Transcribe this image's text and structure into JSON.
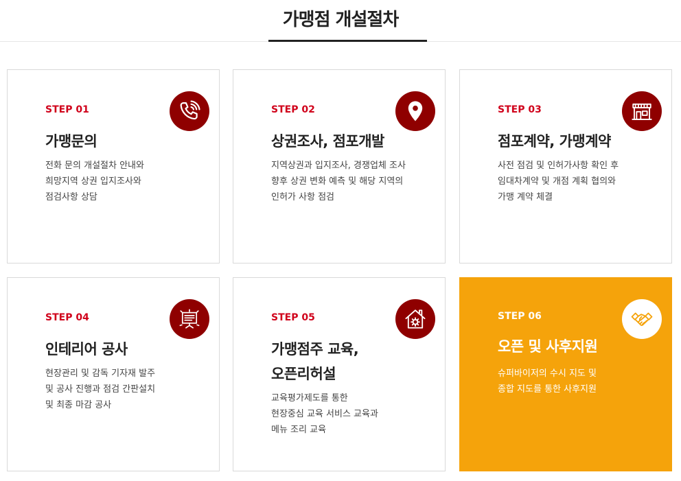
{
  "header": {
    "title": "가맹점 개설절차"
  },
  "steps": [
    {
      "step": "STEP 01",
      "title": "가맹문의",
      "icon": "phone-icon",
      "lines": [
        "전화 문의 개설절차 안내와",
        "희망지역 상권 입지조사와",
        "점검사항 상담"
      ]
    },
    {
      "step": "STEP 02",
      "title": "상권조사, 점포개발",
      "icon": "location-pin-icon",
      "lines": [
        "지역상권과 입지조사, 경쟁업체 조사",
        "향후 상권 변화 예측 및 해당 지역의",
        "인허가 사항 점검"
      ]
    },
    {
      "step": "STEP 03",
      "title": "점포계약, 가맹계약",
      "icon": "storefront-icon",
      "lines": [
        "사전 점검 및 인허가사항 확인 후",
        "임대차계약 및 개점 계획 협의와",
        "가맹 계약 체결"
      ]
    },
    {
      "step": "STEP 04",
      "title": "인테리어 공사",
      "icon": "signboard-icon",
      "lines": [
        "현장관리 및 감독 기자재 발주",
        "및 공사 진행과 점검 간판설치",
        "및 최종 마감 공사"
      ]
    },
    {
      "step": "STEP 05",
      "title_line1": "가맹점주 교육,",
      "title_line2": "오픈리허설",
      "icon": "house-gear-icon",
      "lines": [
        "교육평가제도를 통한",
        "현장중심 교육 서비스 교육과",
        "메뉴 조리 교육"
      ]
    },
    {
      "step": "STEP 06",
      "title": "오픈 및 사후지원",
      "icon": "handshake-icon",
      "lines": [
        "슈퍼바이저의 수시 지도 및",
        "종합 지도를 통한 사후지원"
      ]
    }
  ],
  "colors": {
    "accent_red": "#d0021b",
    "icon_bg": "#8f0000",
    "highlight": "#f5a30b"
  }
}
